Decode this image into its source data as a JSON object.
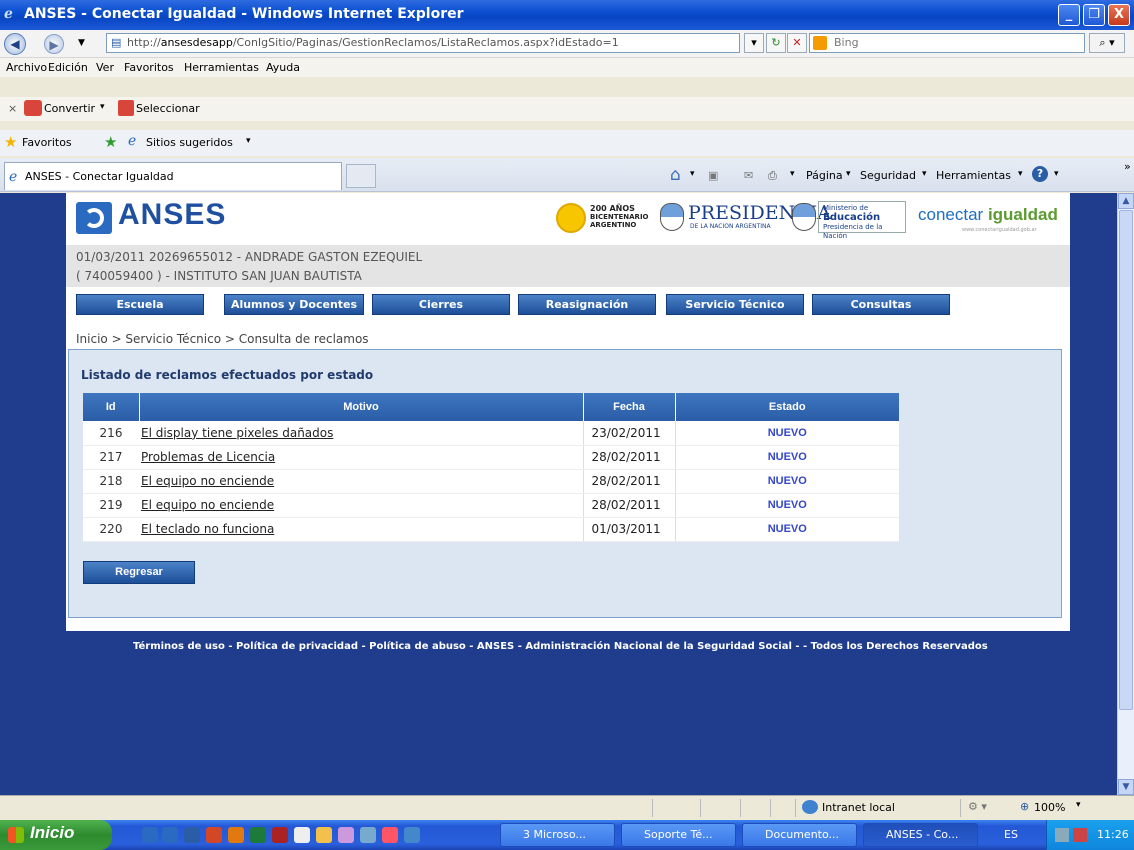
{
  "window": {
    "title": "ANSES - Conectar Igualdad - Windows Internet Explorer",
    "min": "_",
    "max": "❐",
    "close": "X"
  },
  "address": {
    "url_prefix": "http://",
    "url_host": "ansesdesapp",
    "url_path": "/ConIgSitio/Paginas/GestionReclamos/ListaReclamos.aspx?idEstado=1",
    "search_placeholder": "Bing"
  },
  "menu": [
    "Archivo",
    "Edición",
    "Ver",
    "Favoritos",
    "Herramientas",
    "Ayuda"
  ],
  "convert_toolbar": {
    "convertir": "Convertir",
    "seleccionar": "Seleccionar"
  },
  "favorites_bar": {
    "favoritos": "Favoritos",
    "sitios": "Sitios sugeridos"
  },
  "tab": {
    "title": "ANSES - Conectar Igualdad"
  },
  "command_bar": {
    "pagina": "Página",
    "seguridad": "Seguridad",
    "herramientas": "Herramientas"
  },
  "page": {
    "logo_text": "ANSES",
    "bicentenario": [
      "200 AÑOS",
      "BICENTENARIO",
      "ARGENTINO"
    ],
    "presidencia": "PRESIDENCIA",
    "presidencia_sub": "DE LA NACION ARGENTINA",
    "ministerio": [
      "Ministerio de",
      "Educación",
      "Presidencia de la Nación"
    ],
    "conectar": "conectar",
    "igualdad": "igualdad",
    "conectar_sub": "www.conectarigualdad.gob.ar",
    "info_line1": "01/03/2011  20269655012 - ANDRADE GASTON EZEQUIEL",
    "info_line2": "( 740059400 ) - INSTITUTO SAN JUAN BAUTISTA",
    "nav": [
      "Escuela",
      "Alumnos y Docentes",
      "Cierres",
      "Reasignación",
      "Servicio Técnico",
      "Consultas"
    ],
    "breadcrumb": "Inicio > Servicio Técnico > Consulta de reclamos",
    "list_title": "Listado de reclamos efectuados por estado",
    "table": {
      "headers": [
        "Id",
        "Motivo",
        "Fecha",
        "Estado"
      ],
      "rows": [
        {
          "id": "216",
          "motivo": "El display tiene pixeles dañados",
          "fecha": "23/02/2011",
          "estado": "NUEVO"
        },
        {
          "id": "217",
          "motivo": "Problemas de Licencia",
          "fecha": "28/02/2011",
          "estado": "NUEVO"
        },
        {
          "id": "218",
          "motivo": "El equipo no enciende",
          "fecha": "28/02/2011",
          "estado": "NUEVO"
        },
        {
          "id": "219",
          "motivo": "El equipo no enciende",
          "fecha": "28/02/2011",
          "estado": "NUEVO"
        },
        {
          "id": "220",
          "motivo": "El teclado no funciona",
          "fecha": "01/03/2011",
          "estado": "NUEVO"
        }
      ]
    },
    "regresar": "Regresar",
    "footer": "Términos de uso - Política de privacidad - Política de abuso - ANSES - Administración Nacional de la Seguridad Social - - Todos los Derechos Reservados"
  },
  "statusbar": {
    "zone": "Intranet local",
    "zoom": "100%"
  },
  "taskbar": {
    "start": "Inicio",
    "tasks": [
      "3 Microso...",
      "Soporte Té...",
      "Documento...",
      "ANSES - Co..."
    ],
    "lang": "ES",
    "time": "11:26"
  },
  "colors": {
    "page_bg": "#1f3d8c",
    "header_blue": "#2a5da6",
    "estado_blue": "#3346c8",
    "content_bg": "#dbe6f2"
  }
}
